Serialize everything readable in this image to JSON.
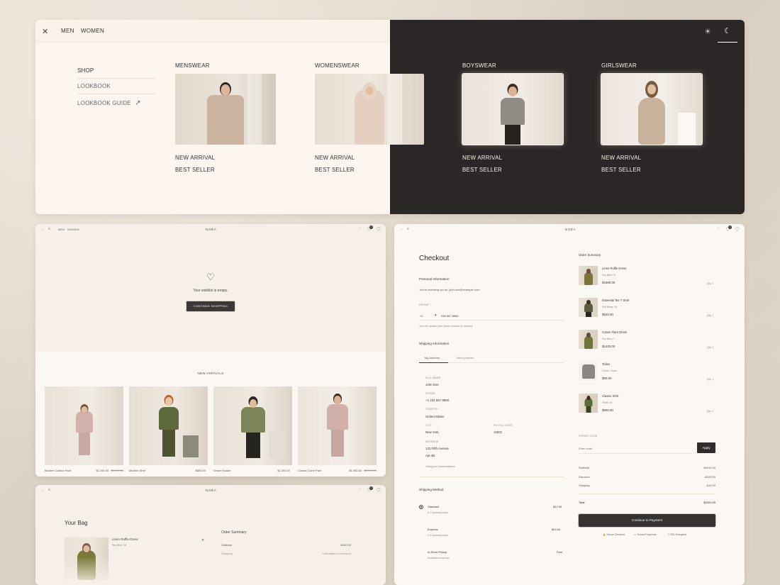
{
  "mega_menu": {
    "nav": [
      "MEN",
      "WOMEN"
    ],
    "side_links": [
      "SHOP",
      "LOOKBOOK",
      "LOOKBOOK GUIDE"
    ],
    "categories": [
      {
        "title": "MENSWEAR",
        "links": [
          "NEW ARRIVAL",
          "BEST SELLER"
        ]
      },
      {
        "title": "WOMENSWEAR",
        "links": [
          "NEW ARRIVAL",
          "BEST SELLER"
        ]
      },
      {
        "title": "BOYSWEAR",
        "links": [
          "NEW ARRIVAL",
          "BEST SELLER"
        ]
      },
      {
        "title": "GIRLSWEAR",
        "links": [
          "NEW ARRIVAL",
          "BEST SELLER"
        ]
      }
    ],
    "close_glyph": "✕",
    "sun_glyph": "☀",
    "moon_glyph": "☾",
    "arrow_glyph": "↗"
  },
  "wishlist": {
    "nav": [
      "MEN",
      "WOMEN"
    ],
    "brand": "NOÉA",
    "cart_count": "0",
    "heart_glyph": "♡",
    "empty_text": "Your wishlist is empty.",
    "cta": "CONTINUE SHOPPING",
    "new_arrivals_title": "NEW ARRIVALS",
    "products": [
      {
        "name": "Modern Classic Pant",
        "price": "$1,250.00",
        "old_price": "$1,550.00"
      },
      {
        "name": "Modern Shirt",
        "price": "$650.00",
        "old_price": ""
      },
      {
        "name": "Smart Hoodie",
        "price": "$1,500.00",
        "old_price": ""
      },
      {
        "name": "Classic Carre Pant",
        "price": "$1,550.00",
        "old_price": "$1,750.00"
      }
    ]
  },
  "bag": {
    "brand": "NOÉA",
    "cart_count": "0",
    "title": "Your Bag",
    "item_name": "Linen Ruffle Dress",
    "item_variant": "Sky Blue / M",
    "close_glyph": "✕",
    "summary_title": "Order Summary",
    "rows": [
      {
        "label": "Subtotal",
        "value": "$440.00"
      },
      {
        "label": "Shipping",
        "value": "Calculated at checkout"
      }
    ]
  },
  "checkout": {
    "brand": "NOÉA",
    "cart_count": "0",
    "title": "Checkout",
    "personal_info": "Personal Information",
    "checking_out_as": "You're checking out as: john.doe@example.com",
    "phone_label": "PHONE *",
    "phone_code": "+1",
    "phone_number": "234 567 8900",
    "phone_hint": "You can update your phone number for delivery",
    "shipping_info": "Shipping Information",
    "tabs": [
      "My Address",
      "New Address"
    ],
    "address": {
      "full_name_label": "FULL NAME",
      "full_name": "John Doe",
      "phone_label": "PHONE",
      "phone": "+1 234 567 8900",
      "country_label": "COUNTRY",
      "country": "United States",
      "city_label": "CITY",
      "city": "New York",
      "postal_label": "POSTAL CODE",
      "postal": "10001",
      "address_label": "ADDRESS",
      "line1": "123 Fifth Avenue",
      "line2": "Apt 4B",
      "saved_hint": "Using your saved address"
    },
    "shipping_method": "Shipping Method",
    "methods": [
      {
        "name": "Standard",
        "eta": "5-7 business days",
        "price": "$12.00"
      },
      {
        "name": "Express",
        "eta": "2-3 business days",
        "price": "$24.00"
      },
      {
        "name": "In-Store Pickup",
        "eta": "Available tomorrow",
        "price": "Free"
      }
    ],
    "summary_title": "Order Summary",
    "items": [
      {
        "name": "Linen Ruffle Dress",
        "variant": "Sky Blue / M",
        "price": "$1500.00",
        "qty": "Qty: 1"
      },
      {
        "name": "Essential Tee T Shirt",
        "variant": "Soft Beige / M",
        "price": "$520.00",
        "qty": "Qty: 1"
      },
      {
        "name": "Cotton Flare Dress",
        "variant": "Sky Blue / L",
        "price": "$1400.00",
        "qty": "Qty: 1"
      },
      {
        "name": "Tidies",
        "variant": "Colors / Sizes",
        "price": "$90.00",
        "qty": "Qty: 1"
      },
      {
        "name": "Classic Shirt",
        "variant": "White / M",
        "price": "$900.00",
        "qty": "Qty: 1"
      }
    ],
    "promo_label": "PROMO CODE",
    "promo_placeholder": "Enter code",
    "apply": "Apply",
    "totals": [
      {
        "label": "Subtotal",
        "value": "$4410.00"
      },
      {
        "label": "Discount",
        "value": "-$220.50"
      },
      {
        "label": "Shipping",
        "value": "$12.00"
      }
    ],
    "total_label": "Total",
    "total_value": "$4201.50",
    "pay_cta": "Continue to Payment",
    "trust_badges": [
      "Secure Checkout",
      "Trusted Payments",
      "SSL Encrypted"
    ]
  },
  "colors": {
    "cream": "#fcf6ee",
    "dark": "#2a2726",
    "button": "#353230"
  }
}
